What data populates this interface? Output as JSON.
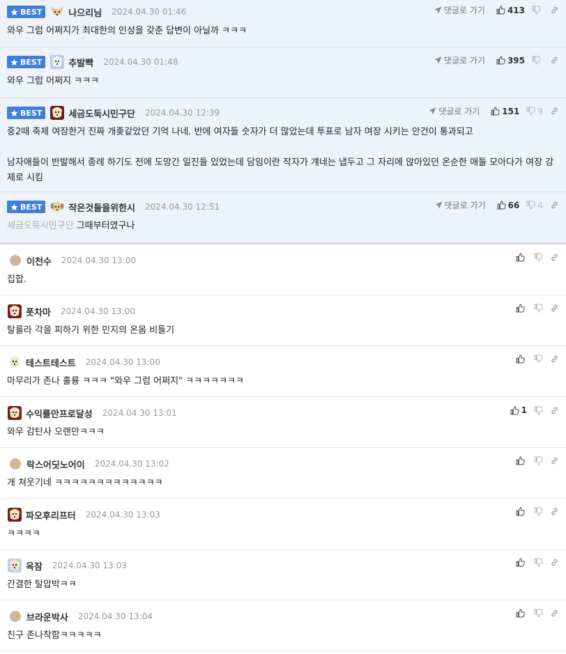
{
  "labels": {
    "best": "BEST",
    "reply_goto": "댓글로 가기"
  },
  "colors": {
    "best_bg": "#eef2f9",
    "badge": "#3f7fd8"
  },
  "best_comments": [
    {
      "author": "나으리님",
      "date": "2024.04.30 01:46",
      "text": "와우 그럼 어쩌지가 최대한의 인성을 갖춘 답변이 아닐까 ㅋㅋㅋ",
      "likes": "413",
      "dislikes": ""
    },
    {
      "author": "추발빡",
      "date": "2024.04.30 01:48",
      "text": "와우 그럼 어쩌지 ㅋㅋㅋ",
      "likes": "395",
      "dislikes": ""
    },
    {
      "author": "세금도둑시민구단",
      "date": "2024.04.30 12:39",
      "text": "중2때 축제 여장한거 진짜 개좆같았던 기억 나네. 반에 여자들 숫자가 더 많았는데 투표로 남자 여장 시키는 안건이 통과되고",
      "text2": "남자애들이 반발해서 종례 하기도 전에 도망간 일진들 있었는데 담임이란 작자가 걔네는 냅두고 그 자리에 앉아있던 온순한 애들 모아다가 여장 강제로 시킴",
      "likes": "151",
      "dislikes": "9"
    },
    {
      "author": "작은것들을위한시",
      "date": "2024.04.30 12:51",
      "mention": "세금도둑시민구단",
      "text": "그때부터였구나",
      "likes": "66",
      "dislikes": "4"
    }
  ],
  "comments": [
    {
      "author": "이천수",
      "date": "2024.04.30 13:00",
      "text": "집합.",
      "likes": ""
    },
    {
      "author": "폿차마",
      "date": "2024.04.30 13:00",
      "text": "탈룰라 각을 피하기 위한 민지의 온몸 비틀기",
      "likes": ""
    },
    {
      "author": "테스트테스트",
      "date": "2024.04.30 13:00",
      "text": "마무리가 존나 훌륭 ㅋㅋㅋ \"와우 그럼 어쩌지\" ㅋㅋㅋㅋㅋㅋㅋ",
      "likes": ""
    },
    {
      "author": "수익률만프로달성",
      "date": "2024.04.30 13:01",
      "text": "와우 감탄사 오랜만ㅋㅋㅋ",
      "likes": "1"
    },
    {
      "author": "락스어딧노어이",
      "date": "2024.04.30 13:02",
      "text": "개 쳐웃기네 ㅋㅋㅋㅋㅋㅋㅋㅋㅋㅋㅋㅋㅋ",
      "likes": ""
    },
    {
      "author": "파오후리프터",
      "date": "2024.04.30 13:03",
      "text": "ㅋㅋㅋㅋ",
      "likes": ""
    },
    {
      "author": "옥잠",
      "date": "2024.04.30 13:03",
      "text": "간결한 탈압박ㅋㅋ",
      "likes": ""
    },
    {
      "author": "브라운박사",
      "date": "2024.04.30 13:04",
      "text": "친구 존나착함ㅋㅋㅋㅋㅋ",
      "likes": ""
    }
  ]
}
